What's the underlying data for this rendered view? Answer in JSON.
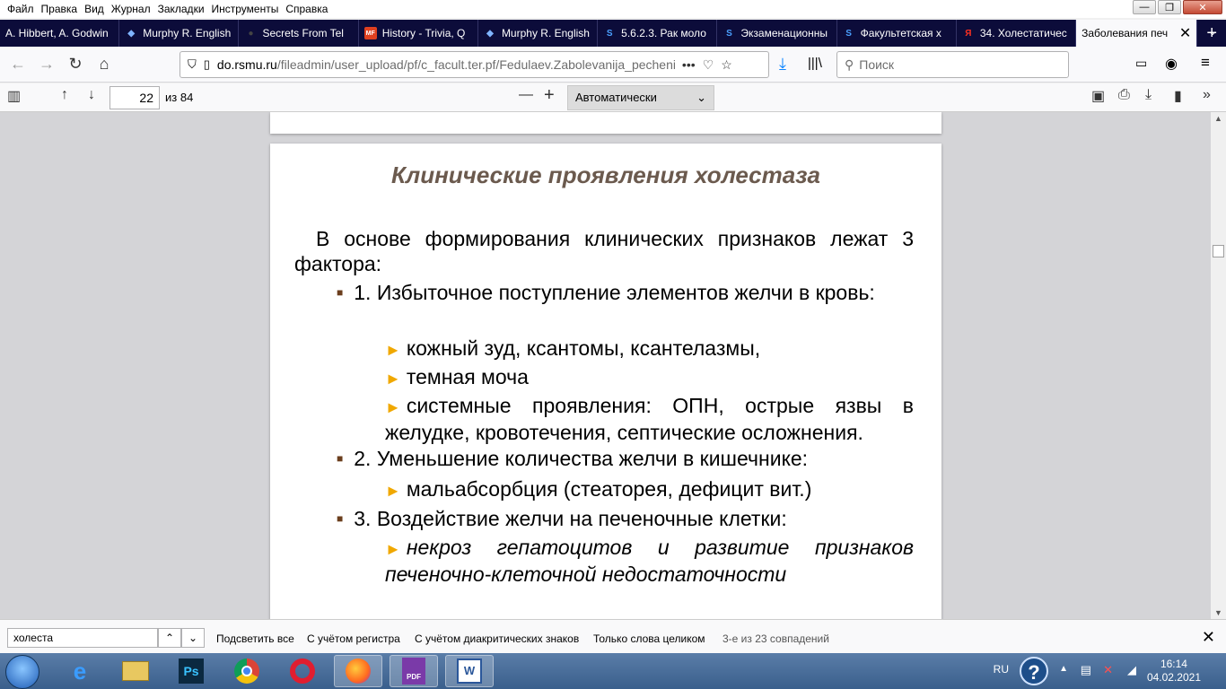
{
  "menu": [
    "Файл",
    "Правка",
    "Вид",
    "Журнал",
    "Закладки",
    "Инструменты",
    "Справка"
  ],
  "window_controls": {
    "minimize": "—",
    "restore": "❐",
    "close": "✕"
  },
  "tabs": [
    {
      "label": "A. Hibbert, A. Godwin",
      "icon": "doc-icon"
    },
    {
      "label": "Murphy R. English",
      "icon": "book-icon"
    },
    {
      "label": "Secrets From Tel",
      "icon": "video-icon"
    },
    {
      "label": "History - Trivia, Q",
      "icon": "mf-icon"
    },
    {
      "label": "Murphy R. English",
      "icon": "book-icon"
    },
    {
      "label": "5.6.2.3. Рак моло",
      "icon": "s-icon"
    },
    {
      "label": "Экзаменационны",
      "icon": "s-icon"
    },
    {
      "label": "Факультетская х",
      "icon": "s-icon"
    },
    {
      "label": "34. Холестатичес",
      "icon": "yandex-icon"
    },
    {
      "label": "Заболевания печ",
      "icon": "pdf-icon",
      "active": true
    }
  ],
  "nav": {
    "url_domain": "do.rsmu.ru",
    "url_path": "/fileadmin/user_upload/pf/c_facult.ter.pf/Fedulaev.Zabolevanija_pecheni.p",
    "search_placeholder": "Поиск"
  },
  "pdf_toolbar": {
    "page_number": "22",
    "page_total": "из 84",
    "zoom": "Автоматически"
  },
  "slide": {
    "title": "Клинические проявления холестаза",
    "intro": "В основе формирования клинических признаков лежат 3 фактора:",
    "item1": "1. Избыточное поступление элементов желчи в кровь:",
    "item1_sub1": "кожный зуд, ксантомы, ксантелазмы,",
    "item1_sub2": "темная моча",
    "item1_sub3": "системные проявления: ОПН, острые язвы в желудке, кровотечения, септические осложнения.",
    "item2": "2. Уменьшение количества желчи  в кишечнике:",
    "item2_sub1": "мальабсорбция (стеаторея, дефицит вит.)",
    "item3": "3. Воздействие желчи на печеночные клетки:",
    "item3_sub1": "некроз гепатоцитов и развитие признаков печеночно-клеточной недостаточности"
  },
  "findbar": {
    "query": "холеста",
    "highlight_all": "Подсветить все",
    "match_case": "С учётом регистра",
    "match_diacritics": "С учётом диакритических знаков",
    "whole_words": "Только слова целиком",
    "status": "3-е из 23 совпадений"
  },
  "taskbar": {
    "lang": "RU",
    "time": "16:14",
    "date": "04.02.2021",
    "apps": [
      "explorer",
      "photoshop",
      "chrome",
      "opera",
      "firefox",
      "pdf-reader",
      "word"
    ]
  },
  "colors": {
    "title": "#6b5a4e",
    "bullet_square": "#6b3e1d",
    "bullet_arrow": "#f0a800",
    "tabbar_bg": "#0c0c3a"
  }
}
